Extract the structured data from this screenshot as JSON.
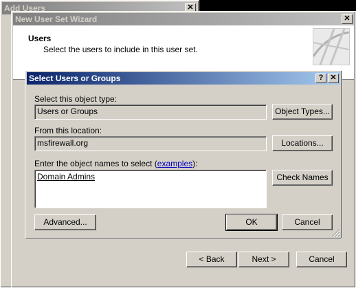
{
  "back_window": {
    "title": "Add Users",
    "close_glyph": "✕"
  },
  "wizard": {
    "title": "New User Set Wizard",
    "close_glyph": "✕",
    "header_title": "Users",
    "header_subtitle": "Select the users to include in this user set.",
    "back_label": "< Back",
    "next_label": "Next >",
    "cancel_label": "Cancel"
  },
  "dialog": {
    "title": "Select Users or Groups",
    "help_glyph": "?",
    "close_glyph": "✕",
    "object_type_label": "Select this object type:",
    "object_type_value": "Users or Groups",
    "object_types_button": "Object Types...",
    "location_label": "From this location:",
    "location_value": "msfirewall.org",
    "locations_button": "Locations...",
    "names_label_prefix": "Enter the object names to select (",
    "names_label_link": "examples",
    "names_label_suffix": "):",
    "names_value": "Domain Admins",
    "check_names_button": "Check Names",
    "advanced_button": "Advanced...",
    "ok_button": "OK",
    "cancel_button": "Cancel"
  },
  "colors": {
    "active_title_start": "#0a246a",
    "active_title_end": "#a6caf0",
    "link": "#0000c0",
    "face": "#d4d0c8"
  }
}
